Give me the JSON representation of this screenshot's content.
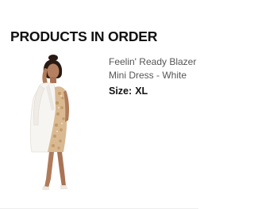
{
  "order": {
    "heading": "PRODUCTS IN ORDER",
    "item": {
      "name_line1": "Feelin' Ready Blazer",
      "name_line2": "Mini Dress - White",
      "size_label": "Size:",
      "size_value": "XL",
      "image_icon": "product-photo"
    }
  },
  "colors": {
    "heading": "#111111",
    "product_name": "#555555",
    "blazer": "#f7f5f2",
    "sequin": "#d9b991",
    "skin": "#b07b5a"
  }
}
